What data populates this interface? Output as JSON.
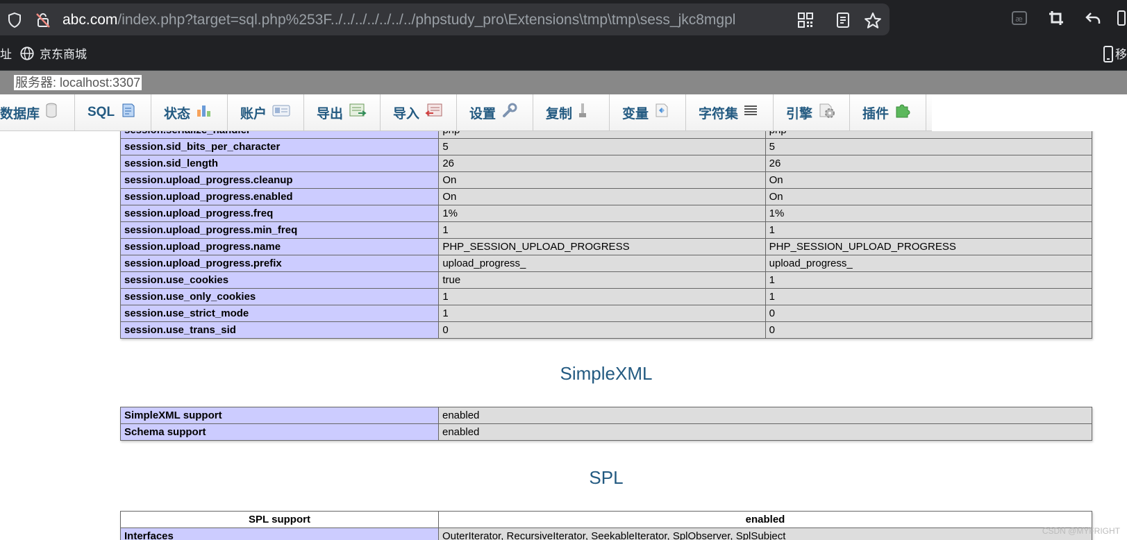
{
  "browser": {
    "url_host": "abc.com",
    "url_path": "/index.php?target=sql.php%253F../../../../../../../phpstudy_pro\\Extensions\\tmp\\tmp\\sess_jkc8mgpl",
    "bookmarks": [
      "址",
      "京东商城"
    ],
    "right_edge_label": "移",
    "icons": [
      "shield-icon",
      "no-tracking-icon",
      "qr-code-icon",
      "reader-mode-icon",
      "star-icon",
      "translate-icon",
      "crop-icon",
      "back-icon",
      "more-icon"
    ]
  },
  "server": {
    "label": "服务器: localhost:3307"
  },
  "menu": {
    "tabs": [
      {
        "label": "数据库",
        "icon": "database-icon"
      },
      {
        "label": "SQL",
        "icon": "sql-doc-icon"
      },
      {
        "label": "状态",
        "icon": "status-chart-icon"
      },
      {
        "label": "账户",
        "icon": "accounts-card-icon"
      },
      {
        "label": "导出",
        "icon": "export-icon"
      },
      {
        "label": "导入",
        "icon": "import-icon"
      },
      {
        "label": "设置",
        "icon": "wrench-icon"
      },
      {
        "label": "复制",
        "icon": "replication-icon"
      },
      {
        "label": "变量",
        "icon": "variables-icon"
      },
      {
        "label": "字符集",
        "icon": "charset-lines-icon"
      },
      {
        "label": "引擎",
        "icon": "engine-gear-icon"
      },
      {
        "label": "插件",
        "icon": "plugin-puzzle-icon"
      }
    ]
  },
  "session_table": {
    "rows": [
      [
        "session.serialize_handler",
        "php",
        "php"
      ],
      [
        "session.sid_bits_per_character",
        "5",
        "5"
      ],
      [
        "session.sid_length",
        "26",
        "26"
      ],
      [
        "session.upload_progress.cleanup",
        "On",
        "On"
      ],
      [
        "session.upload_progress.enabled",
        "On",
        "On"
      ],
      [
        "session.upload_progress.freq",
        "1%",
        "1%"
      ],
      [
        "session.upload_progress.min_freq",
        "1",
        "1"
      ],
      [
        "session.upload_progress.name",
        "PHP_SESSION_UPLOAD_PROGRESS",
        "PHP_SESSION_UPLOAD_PROGRESS"
      ],
      [
        "session.upload_progress.prefix",
        "upload_progress_",
        "upload_progress_"
      ],
      [
        "session.use_cookies",
        "true",
        "1"
      ],
      [
        "session.use_only_cookies",
        "1",
        "1"
      ],
      [
        "session.use_strict_mode",
        "1",
        "0"
      ],
      [
        "session.use_trans_sid",
        "0",
        "0"
      ]
    ]
  },
  "simplexml": {
    "title": "SimpleXML",
    "rows": [
      [
        "SimpleXML support",
        "enabled"
      ],
      [
        "Schema support",
        "enabled"
      ]
    ]
  },
  "spl": {
    "title": "SPL",
    "header": [
      "SPL support",
      "enabled"
    ],
    "rows": [
      [
        "Interfaces",
        "OuterIterator, RecursiveIterator, SeekableIterator, SplObserver, SplSubject"
      ]
    ]
  },
  "watermark": "CSDN @MYFRIGHT"
}
